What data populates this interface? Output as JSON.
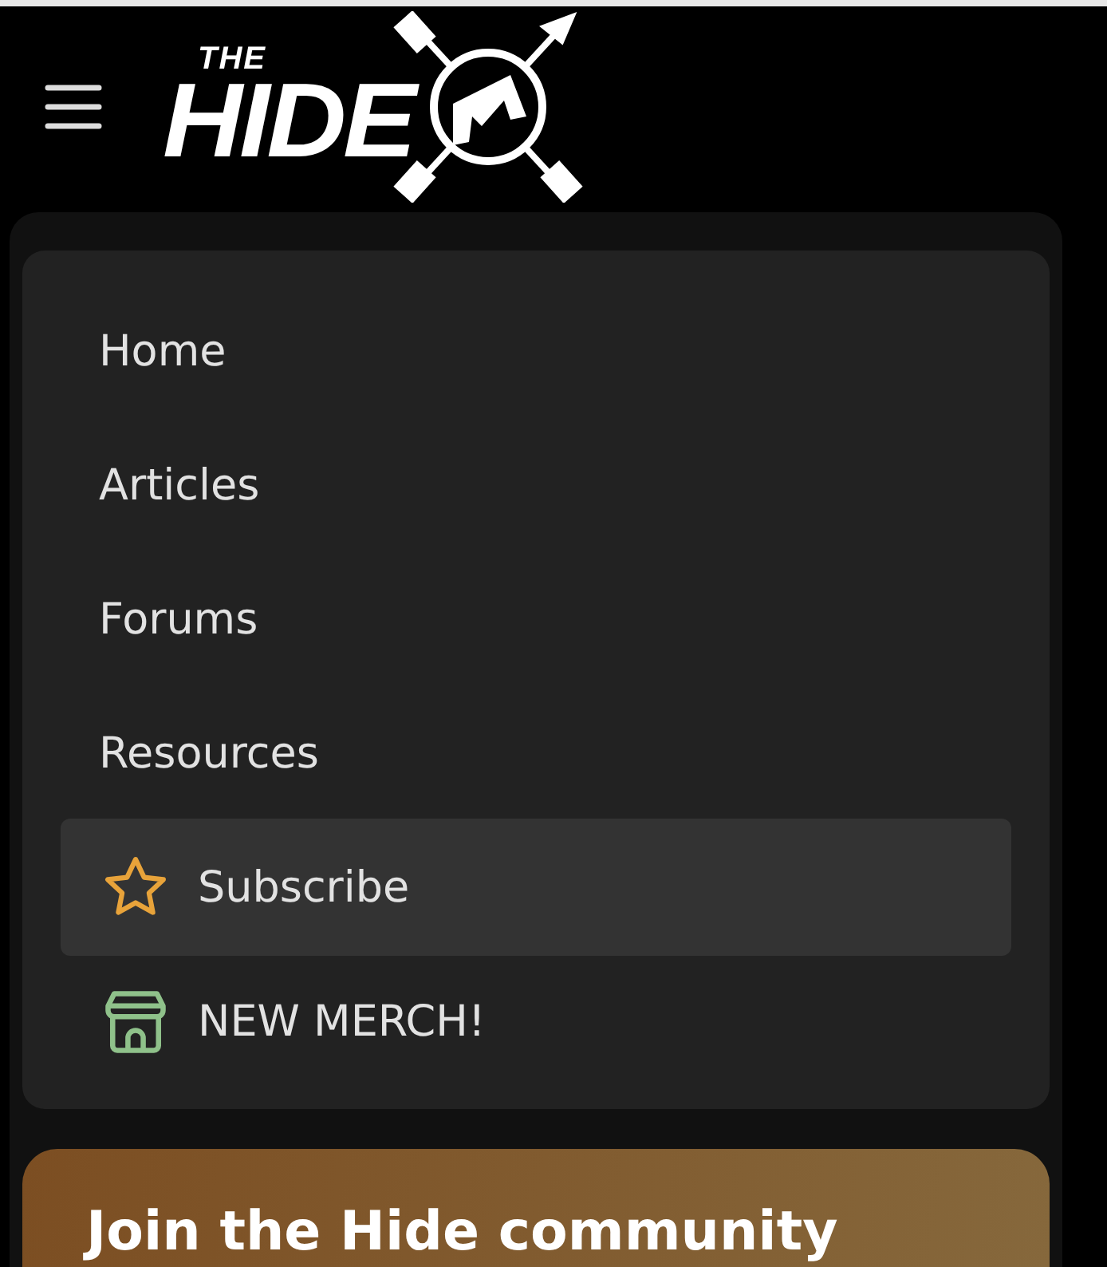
{
  "header": {
    "logo": {
      "small": "THE",
      "large": "HIDE"
    }
  },
  "nav": [
    {
      "label": "Home",
      "kind": "text",
      "selected": false
    },
    {
      "label": "Articles",
      "kind": "text",
      "selected": false
    },
    {
      "label": "Forums",
      "kind": "text",
      "selected": false
    },
    {
      "label": "Resources",
      "kind": "text",
      "selected": false
    },
    {
      "label": "Subscribe",
      "kind": "star",
      "selected": true
    },
    {
      "label": "NEW MERCH!",
      "kind": "store",
      "selected": false
    }
  ],
  "banner": {
    "title": "Join the Hide community"
  }
}
